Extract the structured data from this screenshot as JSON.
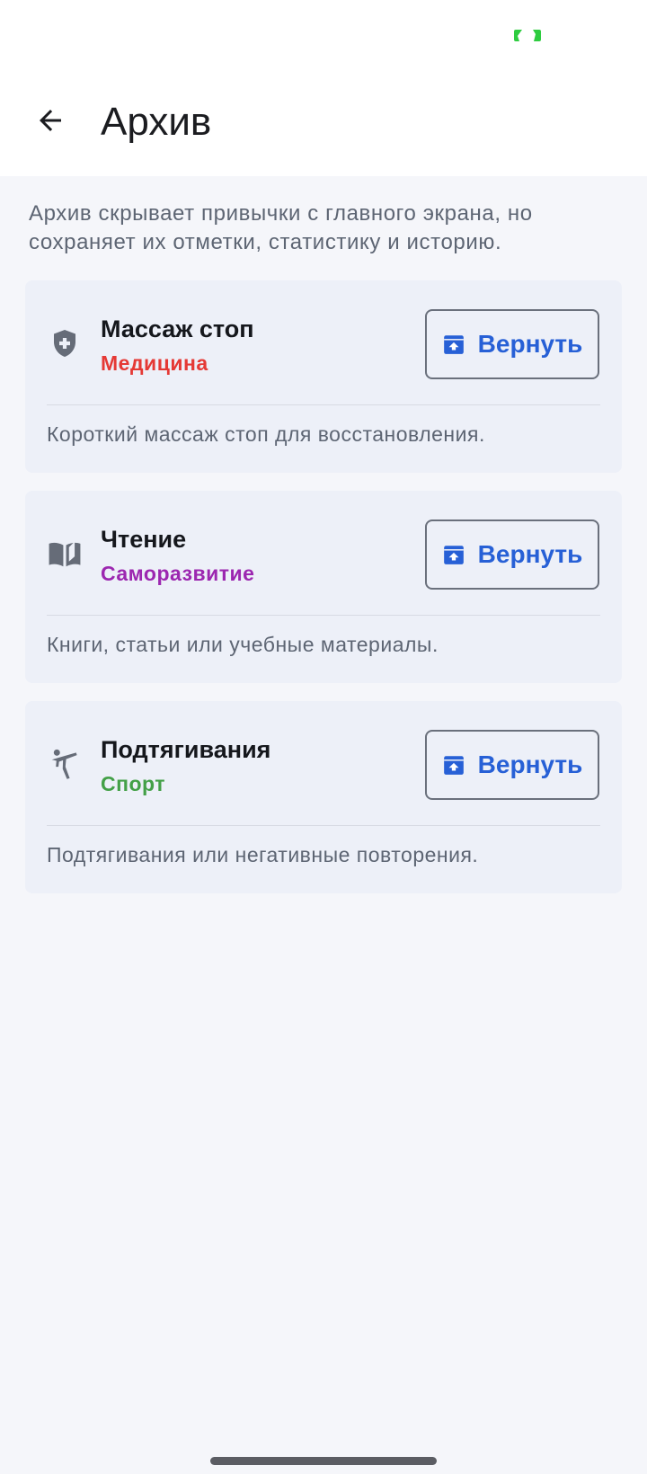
{
  "header": {
    "title": "Архив",
    "back_icon": "arrow-back-icon"
  },
  "info": {
    "text": "Архив скрывает привычки с главного экрана, но сохраняет их отметки, статистику и историю."
  },
  "habits": [
    {
      "name": "Массаж стоп",
      "category": "Медицина",
      "category_color": "#e53935",
      "icon": "shield-plus-icon",
      "description": "Короткий массаж стоп для восстановления.",
      "action_label": "Вернуть"
    },
    {
      "name": "Чтение",
      "category": "Саморазвитие",
      "category_color": "#9c27b0",
      "icon": "book-icon",
      "description": "Книги, статьи или учебные материалы.",
      "action_label": "Вернуть"
    },
    {
      "name": "Подтягивания",
      "category": "Спорт",
      "category_color": "#43a047",
      "icon": "sport-figure-icon",
      "description": "Подтягивания или негативные повторения.",
      "action_label": "Вернуть"
    }
  ],
  "colors": {
    "accent": "#2760d6",
    "card_bg": "#edf0f8",
    "page_bg": "#f5f6fa",
    "status_indicator": "#2ecc40"
  }
}
